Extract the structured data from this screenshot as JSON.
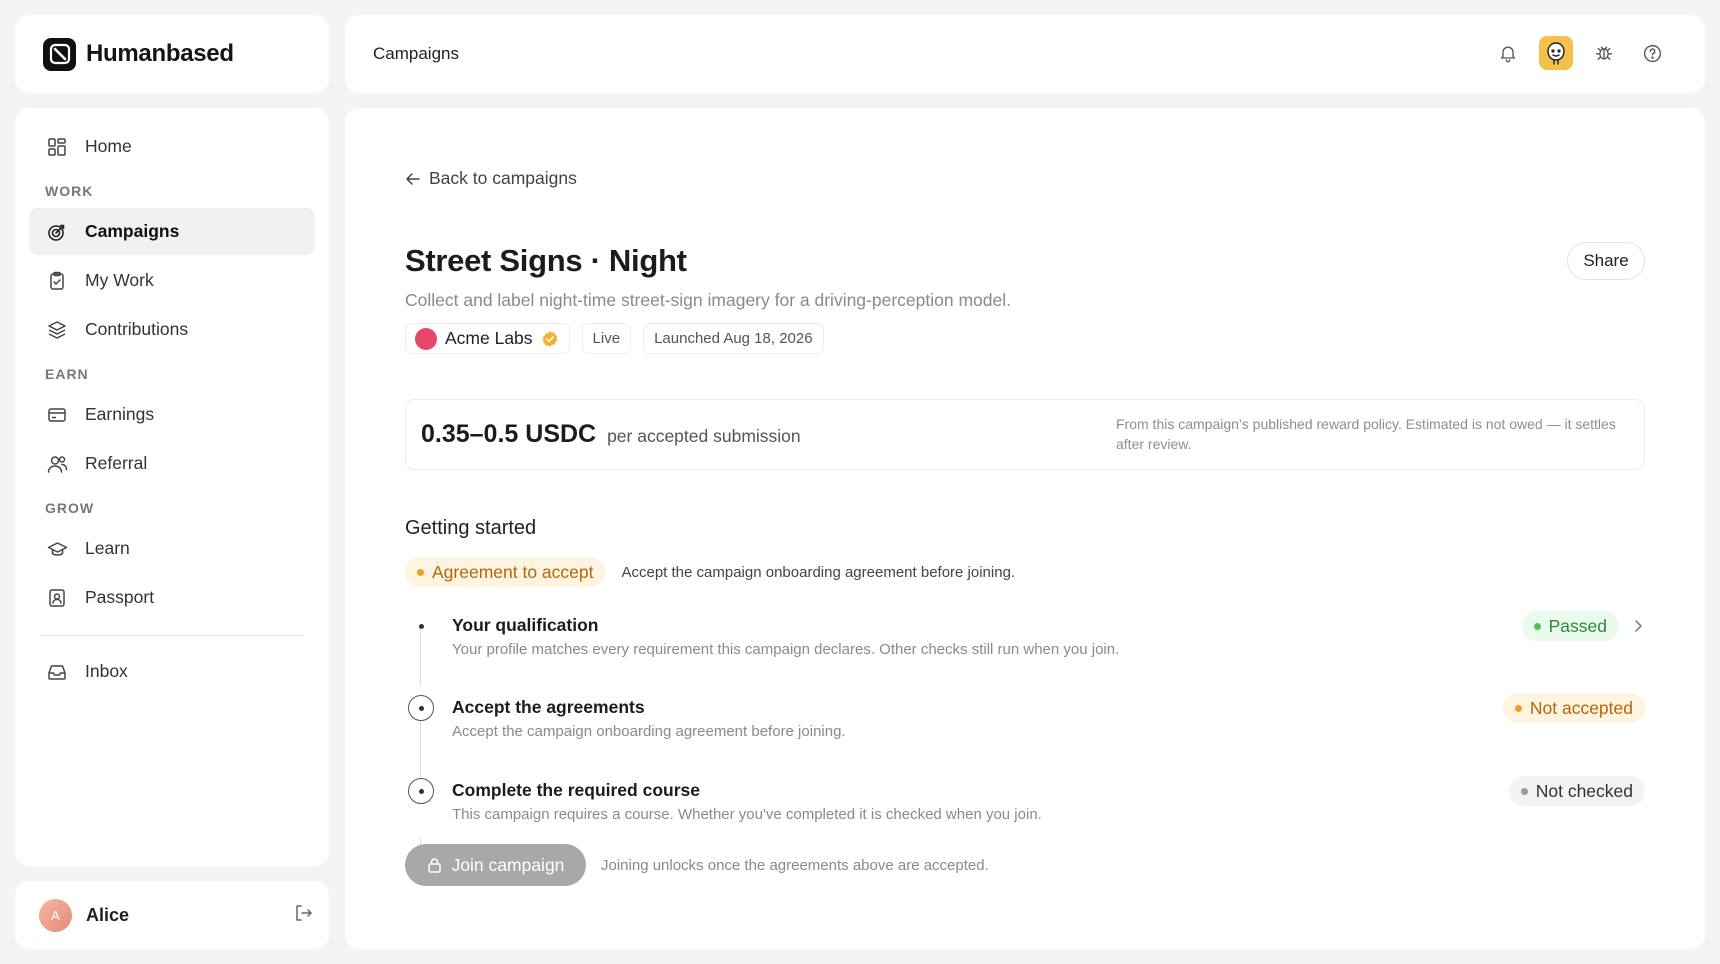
{
  "app": {
    "name": "Humanbased"
  },
  "topbar": {
    "title": "Campaigns",
    "icons": [
      "bell-icon",
      "avatar",
      "bug-icon",
      "help-icon"
    ]
  },
  "sidebar": {
    "home": {
      "label": "Home",
      "icon": "home-grid-icon"
    },
    "sections": [
      {
        "label": "WORK",
        "items": [
          {
            "label": "Campaigns",
            "icon": "target-icon",
            "active": true
          },
          {
            "label": "My Work",
            "icon": "clipboard-icon"
          },
          {
            "label": "Contributions",
            "icon": "layers-icon"
          }
        ]
      },
      {
        "label": "EARN",
        "items": [
          {
            "label": "Earnings",
            "icon": "card-icon"
          },
          {
            "label": "Referral",
            "icon": "users-icon"
          }
        ]
      },
      {
        "label": "GROW",
        "items": [
          {
            "label": "Learn",
            "icon": "graduation-cap-icon"
          },
          {
            "label": "Passport",
            "icon": "id-badge-icon"
          }
        ]
      }
    ],
    "inbox": {
      "label": "Inbox",
      "icon": "inbox-icon"
    }
  },
  "user": {
    "initial": "A",
    "name": "Alice"
  },
  "main": {
    "back_label": "Back to campaigns",
    "title": "Street Signs · Night",
    "subtitle": "Collect and label night-time street-sign imagery for a driving-perception model.",
    "share_label": "Share",
    "org": "Acme Labs",
    "status": "Live",
    "launched": "Launched Aug 18, 2026",
    "reward": {
      "amount": "0.35–0.5 USDC",
      "unit": "per accepted submission",
      "note": "From this campaign’s published reward policy. Estimated is not owed — it settles after review."
    },
    "getting_started": {
      "title": "Getting started",
      "agreement_pill": "Agreement to accept",
      "agreement_desc": "Accept the campaign onboarding agreement before joining.",
      "steps": [
        {
          "title": "Your qualification",
          "desc": "Your profile matches every requirement this campaign declares. Other checks still run when you join.",
          "status": "Passed"
        },
        {
          "title": "Accept the agreements",
          "desc": "Accept the campaign onboarding agreement before joining.",
          "status": "Not accepted"
        },
        {
          "title": "Complete the required course",
          "desc": "This campaign requires a course. Whether you've completed it is checked when you join.",
          "status": "Not checked"
        }
      ]
    },
    "join": {
      "label": "Join campaign",
      "hint": "Joining unlocks once the agreements above are accepted."
    }
  },
  "colors": {
    "accent_amber": "#f0a020",
    "success_green": "#4cc25c",
    "org_dot": "#e8456a",
    "avatar_bg": "#f6c14a"
  }
}
